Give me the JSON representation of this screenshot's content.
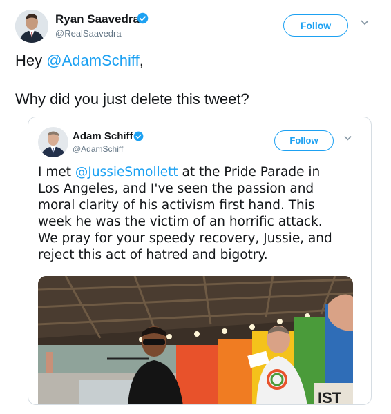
{
  "tweet": {
    "author_name": "Ryan Saavedra",
    "author_handle": "@RealSaavedra",
    "follow_label": "Follow",
    "text_line1_prefix": "Hey ",
    "text_line1_mention": "@AdamSchiff",
    "text_line1_suffix": ",",
    "text_line2": "Why did you just delete this tweet?"
  },
  "quoted": {
    "author_name": "Adam Schiff",
    "author_handle": "@AdamSchiff",
    "follow_label": "Follow",
    "text_prefix": "I met ",
    "text_mention": "@JussieSmollett",
    "text_line1_suffix": " at the Pride Parade in",
    "text_line2": "Los Angeles, and I've seen the passion and",
    "text_line3": "moral clarity of his activism first hand. This",
    "text_line4": "week he was the victim of an horrific attack.",
    "text_line5": "We pray for your speedy recovery, Jussie, and",
    "text_line6": "reject this act of hatred and bigotry.",
    "photo_sign_text": "IST"
  },
  "colors": {
    "accent": "#1da1f2",
    "text": "#14171a",
    "muted": "#657786"
  }
}
